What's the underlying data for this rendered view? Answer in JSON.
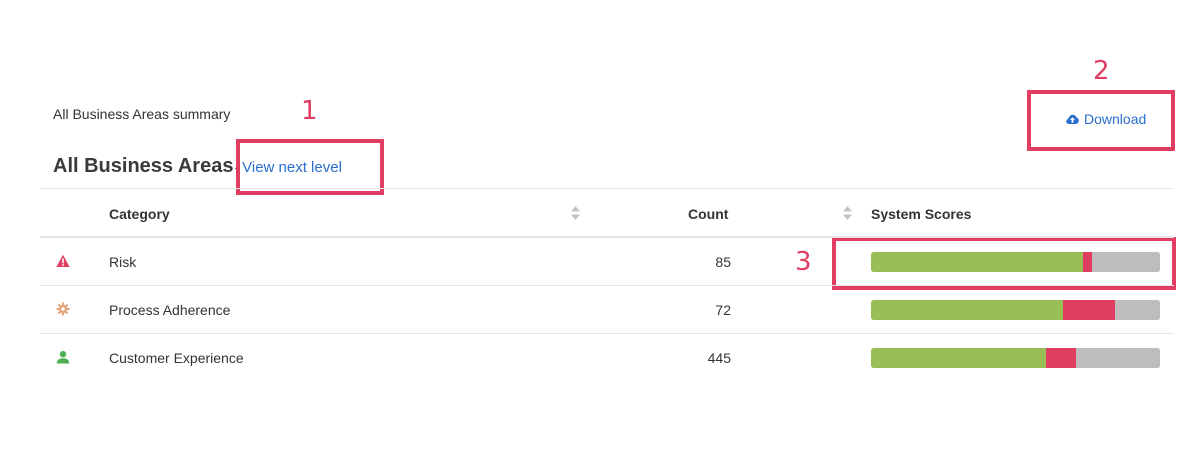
{
  "summary": {
    "label": "All Business Areas summary"
  },
  "heading": {
    "title": "All Business Areas",
    "separator": "-",
    "next_level_link": "View next level"
  },
  "download": {
    "label": "Download",
    "icon": "cloud-upload-icon"
  },
  "callouts": [
    "1",
    "2",
    "3"
  ],
  "table": {
    "columns": {
      "category": "Category",
      "count": "Count",
      "scores": "System Scores"
    },
    "rows": [
      {
        "icon": "warning-triangle-icon",
        "icon_color": "#e03d62",
        "category": "Risk",
        "count": "85",
        "score_good": 0.735,
        "score_bad": 0.03
      },
      {
        "icon": "gear-icon",
        "icon_color": "#e3a57a",
        "category": "Process Adherence",
        "count": "72",
        "score_good": 0.665,
        "score_bad": 0.18
      },
      {
        "icon": "user-icon",
        "icon_color": "#4caf50",
        "category": "Customer Experience",
        "count": "445",
        "score_good": 0.605,
        "score_bad": 0.105
      }
    ]
  },
  "colors": {
    "accent_link": "#2a6ecf",
    "callout": "#e03d62",
    "score_good": "#97bf56",
    "score_bad": "#e03d62",
    "score_na": "#bdbdbd"
  }
}
